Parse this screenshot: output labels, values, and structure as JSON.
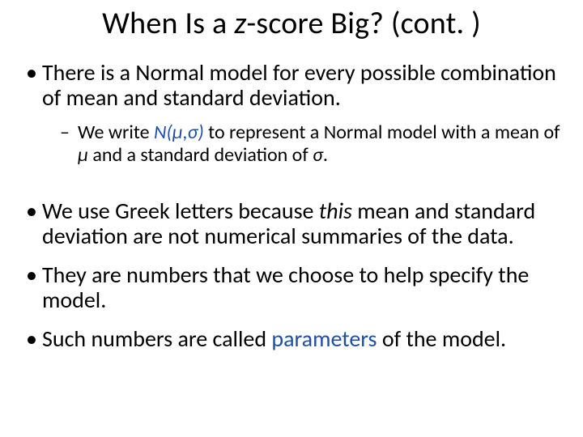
{
  "title_a": "When Is a ",
  "title_z": "z",
  "title_b": "-score Big? (cont. )",
  "b1": "There is a Normal model for every possible combination of mean and standard deviation.",
  "s1_a": "We write ",
  "s1_notation": "N(μ,σ)",
  "s1_b": " to represent a Normal model with a mean of ",
  "s1_mu": "μ",
  "s1_c": " and a standard deviation of ",
  "s1_sigma": "σ",
  "s1_d": ".",
  "b2_a": "We use Greek letters because ",
  "b2_this": "this",
  "b2_b": " mean and standard deviation are not numerical summaries of the data.",
  "b3": "They are numbers that we choose to help specify the model.",
  "b4_a": "Such numbers are called ",
  "b4_param": "parameters",
  "b4_b": " of the model."
}
